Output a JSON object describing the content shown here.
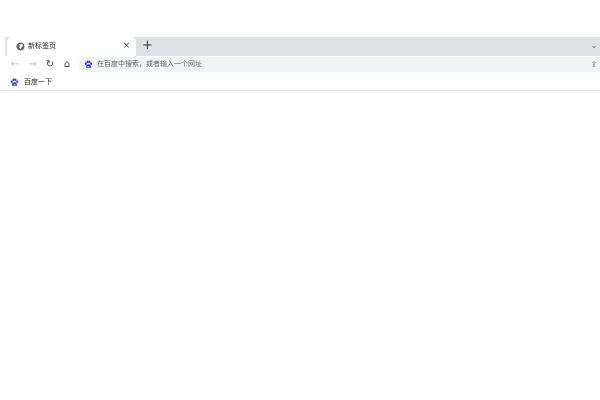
{
  "tabs": [
    {
      "title": "新标签页",
      "icon": "globe-icon",
      "close_glyph": "×"
    }
  ],
  "tabstrip": {
    "new_tab_glyph": "+",
    "search_glyph": "⌄"
  },
  "toolbar": {
    "back_glyph": "←",
    "forward_glyph": "→",
    "reload_glyph": "↻",
    "home_glyph": "⌂"
  },
  "omnibox": {
    "placeholder": "在百度中搜索，或者输入一个网址",
    "search_engine_icon": "baidu-paw-icon",
    "share_glyph": "⇪"
  },
  "bookmarks": [
    {
      "label": "百度一下",
      "icon": "baidu-paw-icon"
    }
  ],
  "colors": {
    "tabstrip_bg": "#dee1e6",
    "omnibox_bg": "#f1f3f4",
    "baidu_blue": "#2932e1",
    "text": "#202124"
  }
}
